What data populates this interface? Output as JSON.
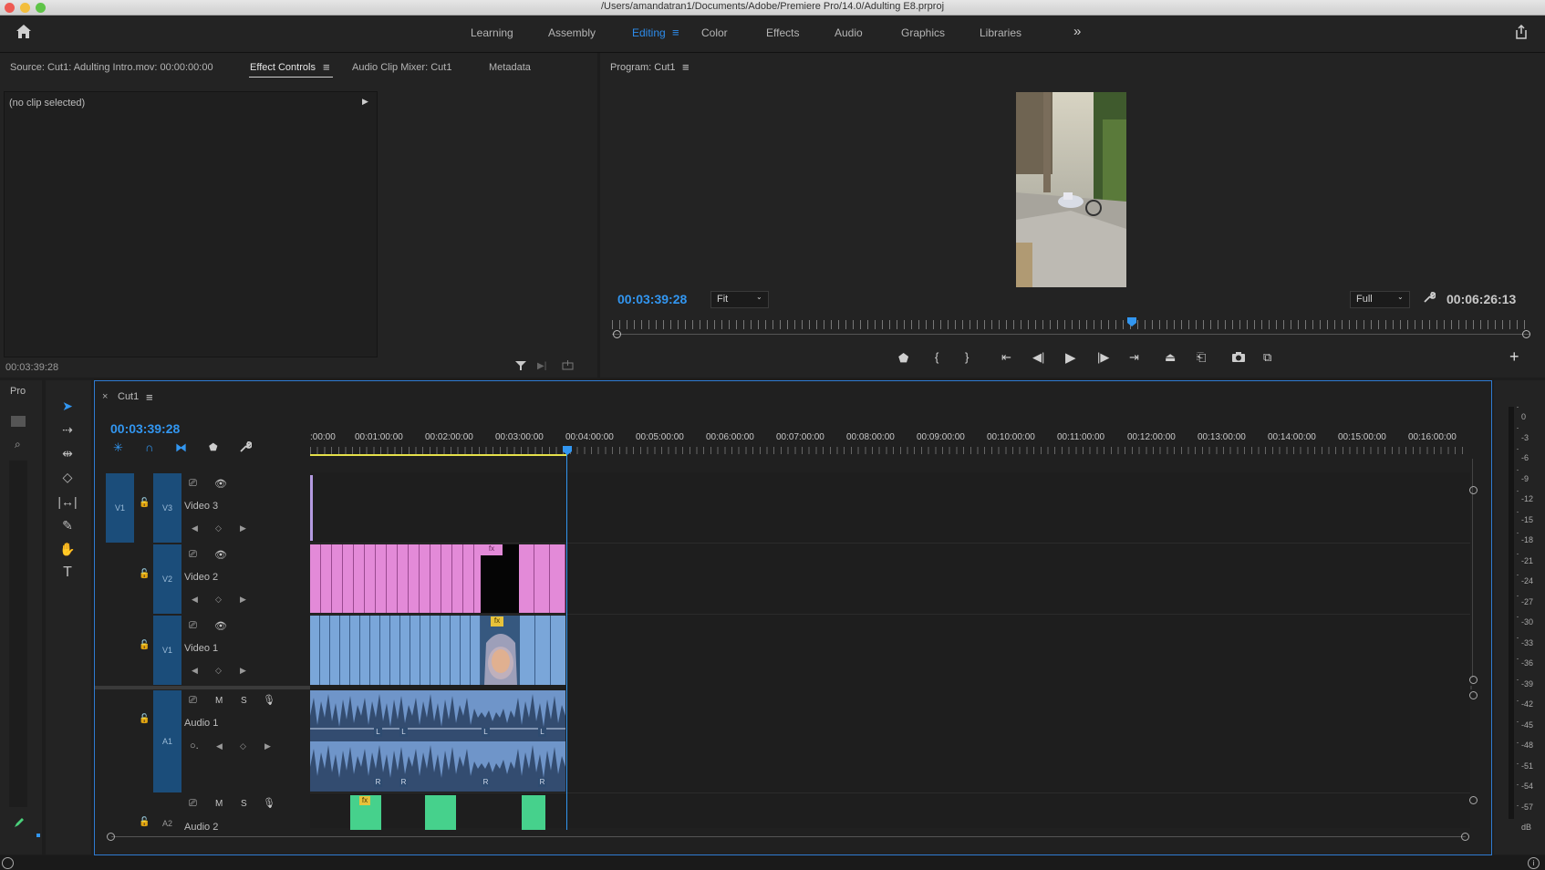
{
  "window": {
    "title": "/Users/amandatran1/Documents/Adobe/Premiere Pro/14.0/Adulting E8.prproj"
  },
  "workspaces": [
    "Learning",
    "Assembly",
    "Editing",
    "Color",
    "Effects",
    "Audio",
    "Graphics",
    "Libraries"
  ],
  "source_panel": {
    "tabs": {
      "source": "Source: Cut1: Adulting Intro.mov: 00:00:00:00",
      "effect_controls": "Effect Controls",
      "audio_mixer": "Audio Clip Mixer: Cut1",
      "metadata": "Metadata"
    },
    "no_clip": "(no clip selected)",
    "timecode": "00:03:39:28"
  },
  "program": {
    "title": "Program: Cut1",
    "timecode": "00:03:39:28",
    "fit": "Fit",
    "quality": "Full",
    "duration": "00:06:26:13"
  },
  "project_panel": {
    "label": "Pro"
  },
  "timeline": {
    "sequence": "Cut1",
    "timecode": "00:03:39:28",
    "ruler": [
      ":00:00",
      "00:01:00:00",
      "00:02:00:00",
      "00:03:00:00",
      "00:04:00:00",
      "00:05:00:00",
      "00:06:00:00",
      "00:07:00:00",
      "00:08:00:00",
      "00:09:00:00",
      "00:10:00:00",
      "00:11:00:00",
      "00:12:00:00",
      "00:13:00:00",
      "00:14:00:00",
      "00:15:00:00",
      "00:16:00:00"
    ],
    "tracks": {
      "v3": {
        "src": "V1",
        "id": "V3",
        "name": "Video 3"
      },
      "v2": {
        "id": "V2",
        "name": "Video 2"
      },
      "v1": {
        "id": "V1",
        "name": "Video 1"
      },
      "a1": {
        "id": "A1",
        "name": "Audio 1"
      },
      "a2": {
        "id": "A2",
        "name": "Audio 2"
      }
    },
    "fx": "fx",
    "m": "M",
    "s": "S",
    "l": "L",
    "r": "R"
  },
  "meter": {
    "ticks": [
      "0",
      "-3",
      "-6",
      "-9",
      "-12",
      "-15",
      "-18",
      "-21",
      "-24",
      "-27",
      "-30",
      "-33",
      "-36",
      "-39",
      "-42",
      "-45",
      "-48",
      "-51",
      "-54",
      "-57",
      "dB"
    ]
  },
  "colors": {
    "accent": "#2d8ceb",
    "video2_clip": "#e38ad8",
    "video1_clip": "#7aa6d9",
    "audio2_clip": "#46d18c"
  }
}
